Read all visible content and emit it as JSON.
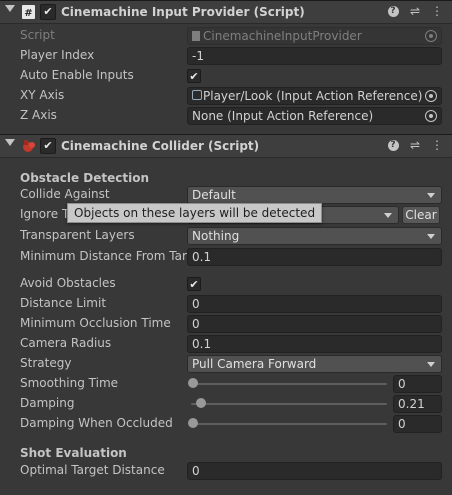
{
  "input_provider": {
    "title": "Cinemachine Input Provider (Script)",
    "enabled_check": "✔",
    "script_label": "Script",
    "script_value": "CinemachineInputProvider",
    "player_index_label": "Player Index",
    "player_index_value": "-1",
    "auto_enable_label": "Auto Enable Inputs",
    "auto_enable_check": "✔",
    "xy_axis_label": "XY Axis",
    "xy_axis_value": "Player/Look (Input Action Reference)",
    "z_axis_label": "Z Axis",
    "z_axis_value": "None (Input Action Reference)"
  },
  "collider": {
    "title": "Cinemachine Collider (Script)",
    "enabled_check": "✔",
    "obstacle_section": "Obstacle Detection",
    "collide_against_label": "Collide Against",
    "collide_against_value": "Default",
    "ignore_tag_label": "Ignore T",
    "clear_label": "Clear",
    "transparent_layers_label": "Transparent Layers",
    "transparent_layers_value": "Nothing",
    "min_distance_label": "Minimum Distance From Targe",
    "min_distance_value": "0.1",
    "avoid_obstacles_label": "Avoid Obstacles",
    "avoid_obstacles_check": "✔",
    "distance_limit_label": "Distance Limit",
    "distance_limit_value": "0",
    "min_occlusion_label": "Minimum Occlusion Time",
    "min_occlusion_value": "0",
    "camera_radius_label": "Camera Radius",
    "camera_radius_value": "0.1",
    "strategy_label": "Strategy",
    "strategy_value": "Pull Camera Forward",
    "smoothing_label": "Smoothing Time",
    "smoothing_value": "0",
    "damping_label": "Damping",
    "damping_value": "0.21",
    "damping_occluded_label": "Damping When Occluded",
    "damping_occluded_value": "0",
    "shot_section": "Shot Evaluation",
    "optimal_target_label": "Optimal Target Distance",
    "optimal_target_value": "0"
  },
  "tooltip": "Objects on these layers will be detected",
  "sliders": {
    "smoothing_fraction": 0.0,
    "damping_fraction": 0.04,
    "damping_occluded_fraction": 0.0
  },
  "header_icons": {
    "help": "?",
    "presets": "⇌",
    "menu": "⋮"
  }
}
